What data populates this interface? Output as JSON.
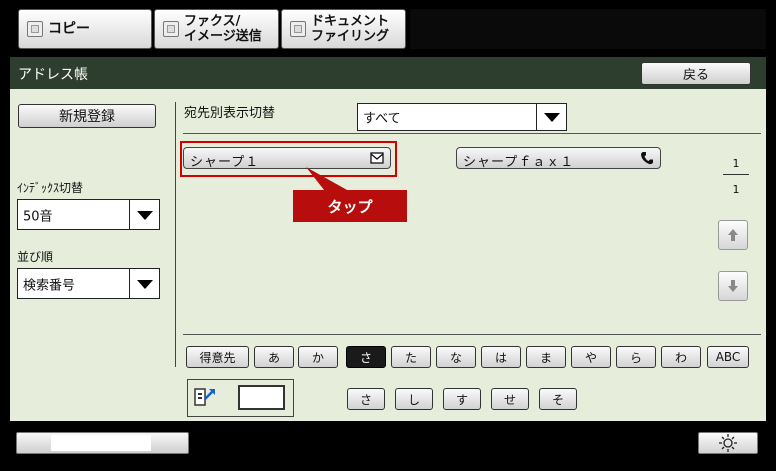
{
  "mode_tabs": [
    {
      "label": "コピー"
    },
    {
      "label": "ファクス/\nイメージ送信"
    },
    {
      "label": "ドキュメント\nファイリング"
    }
  ],
  "header": {
    "title": "アドレス帳",
    "back_label": "戻る"
  },
  "sidebar": {
    "register_label": "新規登録",
    "index_label": "ｲﾝﾃﾞｯｸｽ切替",
    "index_value": "50音",
    "sort_label": "並び順",
    "sort_value": "検索番号"
  },
  "filter": {
    "label": "宛先別表示切替",
    "value": "すべて"
  },
  "entries": [
    {
      "name": "シャープ１",
      "icon": "mail-icon"
    },
    {
      "name": "シャープｆａｘ１",
      "icon": "phone-icon"
    }
  ],
  "callout": {
    "label": "タップ"
  },
  "pager": {
    "current": "1",
    "total": "1"
  },
  "index_keys": [
    "得意先",
    "あ",
    "か",
    "さ",
    "た",
    "な",
    "は",
    "ま",
    "や",
    "ら",
    "わ",
    "ABC"
  ],
  "active_key": "さ",
  "sub_keys": [
    "さ",
    "し",
    "す",
    "せ",
    "そ"
  ],
  "colors": {
    "accent_red": "#b80d0d",
    "title_bar": "#2d3d2e",
    "panel_bg": "#e6eedb"
  }
}
